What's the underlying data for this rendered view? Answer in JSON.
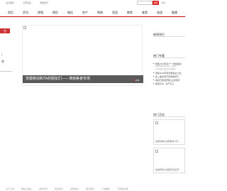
{
  "topbar": {
    "links": [
      "设为首页",
      "万家社区",
      "安徽资讯"
    ],
    "search_placeholder": "",
    "search_button": "搜索",
    "search_hint": "搜索"
  },
  "nav": {
    "items": [
      "首页",
      "资讯",
      "视频",
      "便民",
      "微信",
      "房产",
      "购物",
      "家居",
      "教育",
      "美食",
      "旅游",
      "健康"
    ]
  },
  "left": {
    "red_tag": "合",
    "line1": "l",
    "line2": "合"
  },
  "hero": {
    "caption": "安徽移动和TA的朋友们——淮南美食专场"
  },
  "sidebar": {
    "rank_title": "新闻排行",
    "tags_title": "热门专题",
    "tags": [
      {
        "text": "聚焦2018年双十一购物盛会",
        "sub": "5月26日至6月1日，10万件..."
      },
      {
        "text": "",
        "sub": "汽车居家·品质生活送精彩"
      },
      {
        "text": "聚焦2018年世界制造业大会",
        "sub": ""
      },
      {
        "text": "第二届世界声音博物馆节",
        "sub": ""
      },
      {
        "text": "春和日暖游安徽·全省旅游",
        "sub": ""
      },
      {
        "text": "美丽乡村 · 生产双三",
        "sub": ""
      }
    ],
    "activity_title": "热门活动",
    "activities": [
      {
        "caption": "[免费体验] 合肥美食 5月..."
      },
      {
        "caption": "[免费申请] 海底捞 新店开..."
      }
    ]
  },
  "footer": {
    "links": [
      "关于万家",
      "网站大事记",
      "合作伙伴",
      "联系我们",
      "招聘信息",
      "联系我们",
      "广告服务",
      "万家客户端"
    ]
  }
}
